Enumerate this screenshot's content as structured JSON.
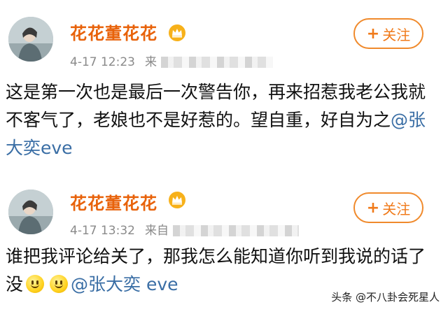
{
  "posts": [
    {
      "username": "花花董花花",
      "time": "4-17 12:23",
      "source_prefix": "来",
      "follow_label": "关注",
      "follow_plus": "+",
      "text_before_mention": "这是第一次也是最后一次警告你，再来招惹我老公我就不客气了，老娘也不是好惹的。望自重，好自为之",
      "mention": "@张大奕eve"
    },
    {
      "username": "花花董花花",
      "time": "4-17 13:32",
      "source_prefix": "来自",
      "follow_label": "关注",
      "follow_plus": "+",
      "text_before_mention": "谁把我评论给关了，那我怎么能知道你听到我说的话了没",
      "mention": "@张大奕 eve"
    }
  ],
  "watermark": "头条 @不八卦会死星人",
  "colors": {
    "username": "#e8620a",
    "follow_border": "#f08a2c",
    "mention": "#3a6ea5",
    "meta": "#8a8a8a"
  },
  "icons": [
    "avatar",
    "vip-crown-icon",
    "smiley-icon"
  ]
}
